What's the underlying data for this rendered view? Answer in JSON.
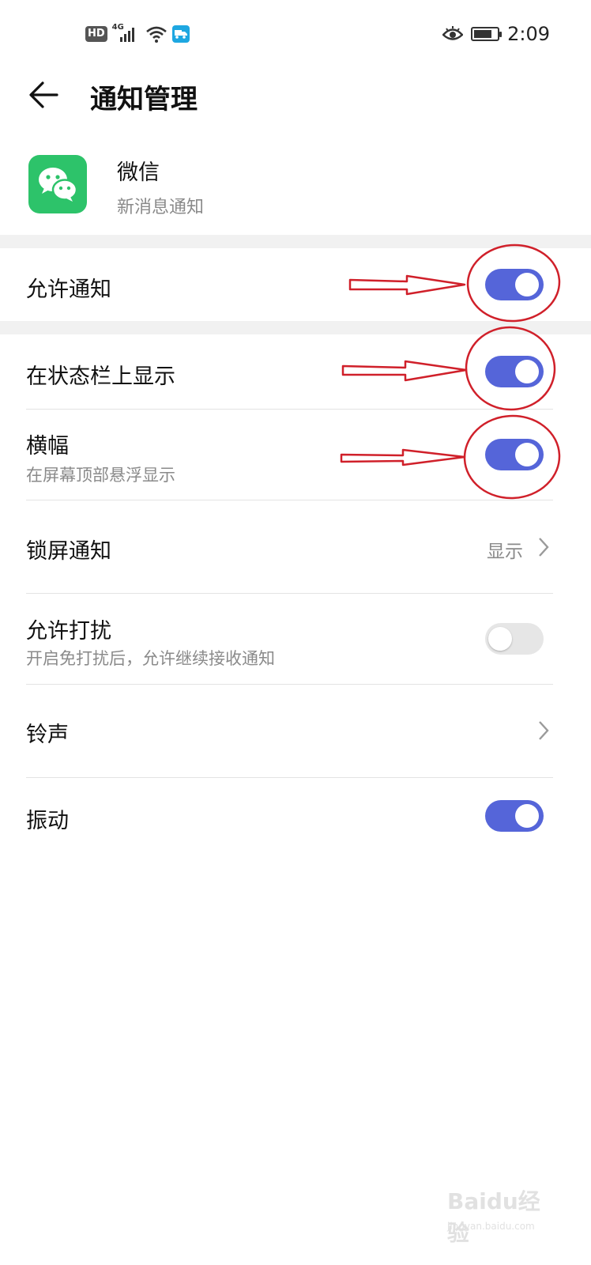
{
  "status_bar": {
    "hd": "HD",
    "network": "4G",
    "time": "2:09",
    "battery_level": 0.8
  },
  "header": {
    "title": "通知管理"
  },
  "app": {
    "name": "微信",
    "subtitle": "新消息通知",
    "icon": "wechat-logo",
    "icon_color": "#2dc36a"
  },
  "settings": {
    "allow_notifications": {
      "label": "允许通知",
      "on": true
    },
    "status_bar_display": {
      "label": "在状态栏上显示",
      "on": true
    },
    "banner": {
      "label": "横幅",
      "sub": "在屏幕顶部悬浮显示",
      "on": true
    },
    "lock_screen": {
      "label": "锁屏通知",
      "value": "显示"
    },
    "allow_dnd": {
      "label": "允许打扰",
      "sub": "开启免打扰后，允许继续接收通知",
      "on": false
    },
    "ringtone": {
      "label": "铃声"
    },
    "vibration": {
      "label": "振动",
      "on": true
    }
  },
  "colors": {
    "toggle_on": "#5565d9",
    "toggle_off": "#e6e6e6",
    "annotation": "#d0202a"
  },
  "watermark": {
    "brand": "Baidu经验",
    "url": "jingyan.baidu.com"
  }
}
